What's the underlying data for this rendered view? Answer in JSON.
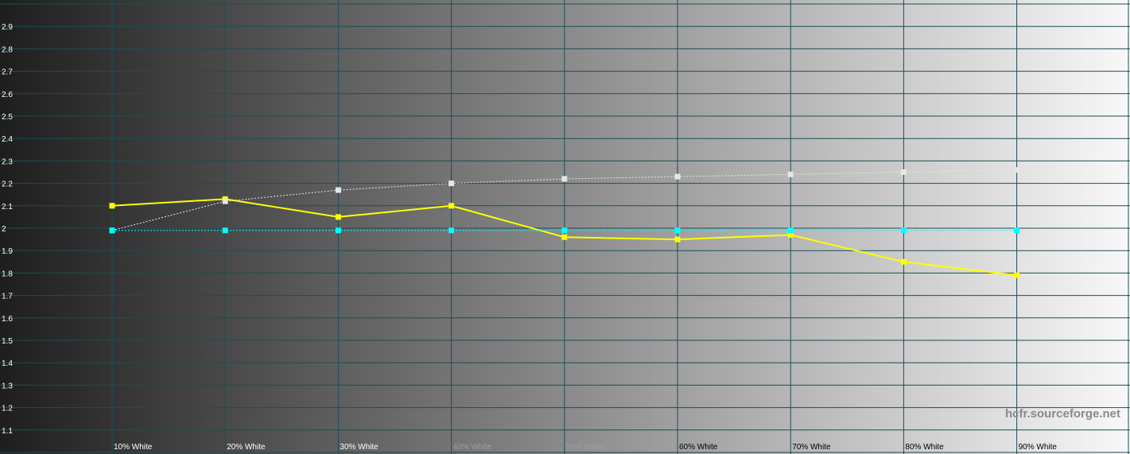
{
  "chart_data": {
    "type": "line",
    "categories": [
      "10% White",
      "20% White",
      "30% White",
      "40% White",
      "50% White",
      "60% White",
      "70% White",
      "80% White",
      "90% White"
    ],
    "ylim": [
      1.0,
      3.0
    ],
    "y_ticks": [
      "1.1",
      "1.2",
      "1.3",
      "1.4",
      "1.5",
      "1.6",
      "1.7",
      "1.8",
      "1.9",
      "2",
      "2.1",
      "2.2",
      "2.3",
      "2.4",
      "2.5",
      "2.6",
      "2.7",
      "2.8",
      "2.9"
    ],
    "grid": true,
    "background": "grayscale-gradient",
    "series": [
      {
        "values": [
          2.1,
          2.13,
          2.05,
          2.1,
          1.96,
          1.95,
          1.97,
          1.85,
          1.79
        ],
        "color": "#ffff00",
        "style": "solid"
      },
      {
        "values": [
          1.99,
          2.12,
          2.17,
          2.2,
          2.22,
          2.23,
          2.24,
          2.25,
          2.26
        ],
        "color": "#e6e6e6",
        "style": "dotted"
      },
      {
        "values": [
          1.99,
          1.99,
          1.99,
          1.99,
          1.99,
          1.99,
          1.99,
          1.99,
          1.99
        ],
        "color": "#00ffff",
        "style": "dotted"
      }
    ]
  },
  "watermark": "hcfr.sourceforge.net"
}
